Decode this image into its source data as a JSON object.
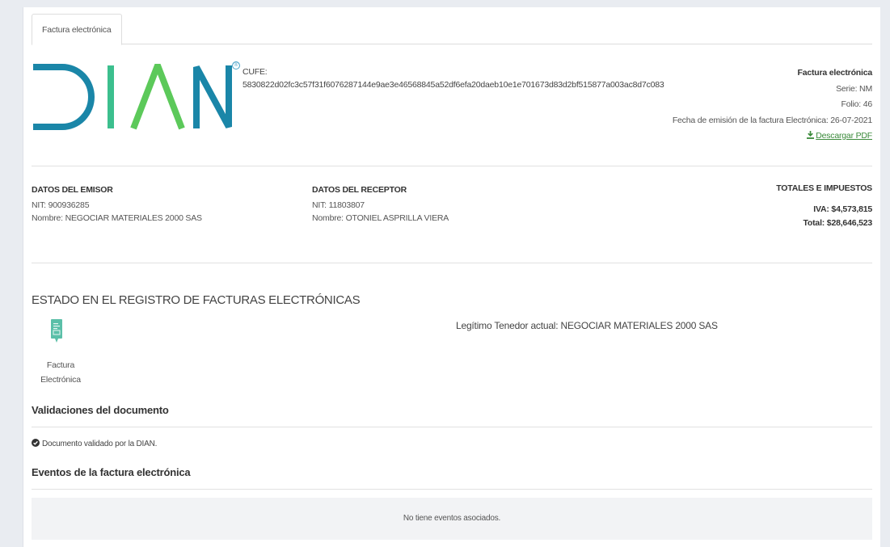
{
  "tabs": [
    {
      "label": "Factura electrónica"
    }
  ],
  "logo": {
    "text": "DIAN",
    "colors": {
      "d": "#1a86a8",
      "i": "#3cbf8e",
      "a": "#5cc95a",
      "n": "#1a86a8"
    }
  },
  "cufe": {
    "label": "CUFE:",
    "value": "5830822d02fc3c57f31f6076287144e9ae3e46568845a52df6efa20daeb10e1e701673d83d2bf515877a003ac8d7c083"
  },
  "invoice": {
    "title": "Factura electrónica",
    "serie": "Serie: NM",
    "folio": "Folio: 46",
    "fecha": "Fecha de emisión de la factura Electrónica: 26-07-2021",
    "pdf_link": "Descargar PDF",
    "pdf_icon": "download-icon"
  },
  "emisor": {
    "heading": "DATOS DEL EMISOR",
    "nit": "NIT: 900936285",
    "nombre": "Nombre: NEGOCIAR MATERIALES 2000 SAS"
  },
  "receptor": {
    "heading": "DATOS DEL RECEPTOR",
    "nit": "NIT: 11803807",
    "nombre": "Nombre: OTONIEL ASPRILLA VIERA"
  },
  "totales": {
    "heading": "TOTALES E IMPUESTOS",
    "iva": "IVA: $4,573,815",
    "total": "Total: $28,646,523"
  },
  "estado": {
    "title": "ESTADO EN EL REGISTRO DE FACTURAS ELECTRÓNICAS",
    "icon_label_1": "Factura",
    "icon_label_2": "Electrónica",
    "tenedor": "Legítimo Tenedor actual: NEGOCIAR MATERIALES 2000 SAS",
    "icon": "invoice-document-icon",
    "icon_color": "#5bbfa8"
  },
  "validaciones": {
    "title": "Validaciones del documento",
    "item": "Documento validado por la DIAN.",
    "icon": "check-circle-icon"
  },
  "eventos": {
    "title": "Eventos de la factura electrónica",
    "empty": "No tiene eventos asociados."
  }
}
